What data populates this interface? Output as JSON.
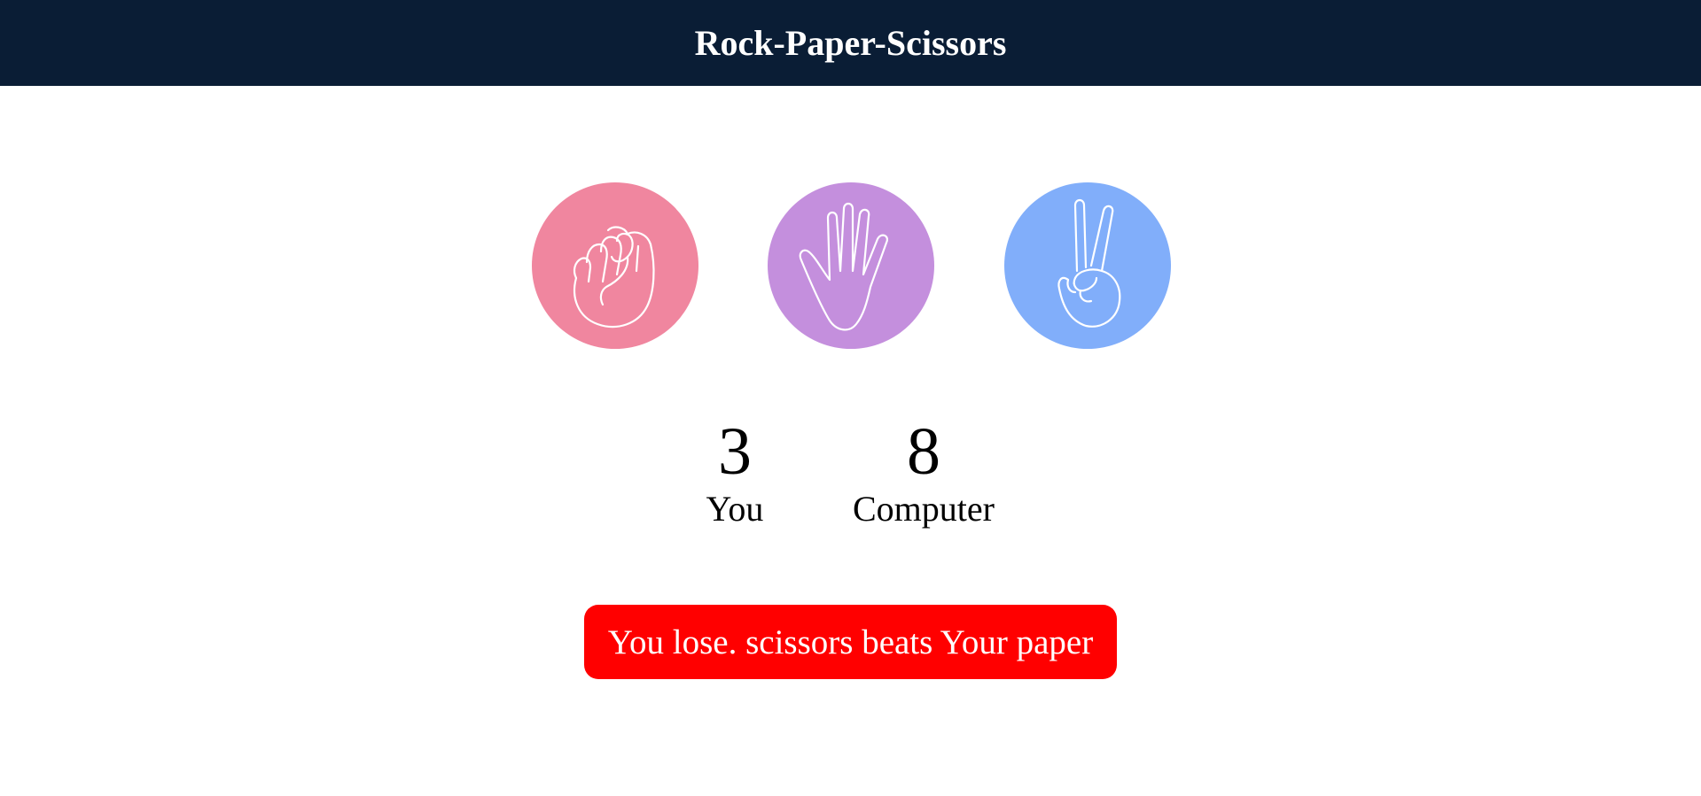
{
  "header": {
    "title": "Rock-Paper-Scissors"
  },
  "choices": [
    {
      "id": "rock",
      "icon": "fist-icon",
      "color": "#f0869f"
    },
    {
      "id": "paper",
      "icon": "open-hand-icon",
      "color": "#c48fdd"
    },
    {
      "id": "scissors",
      "icon": "peace-sign-icon",
      "color": "#81aefa"
    }
  ],
  "scoreboard": {
    "you": {
      "score": "3",
      "label": "You"
    },
    "computer": {
      "score": "8",
      "label": "Computer"
    }
  },
  "result": {
    "text": "You lose. scissors beats Your paper",
    "color": "#ff0000"
  },
  "colors": {
    "header_bg": "#0a1d35",
    "header_text": "#ffffff"
  }
}
